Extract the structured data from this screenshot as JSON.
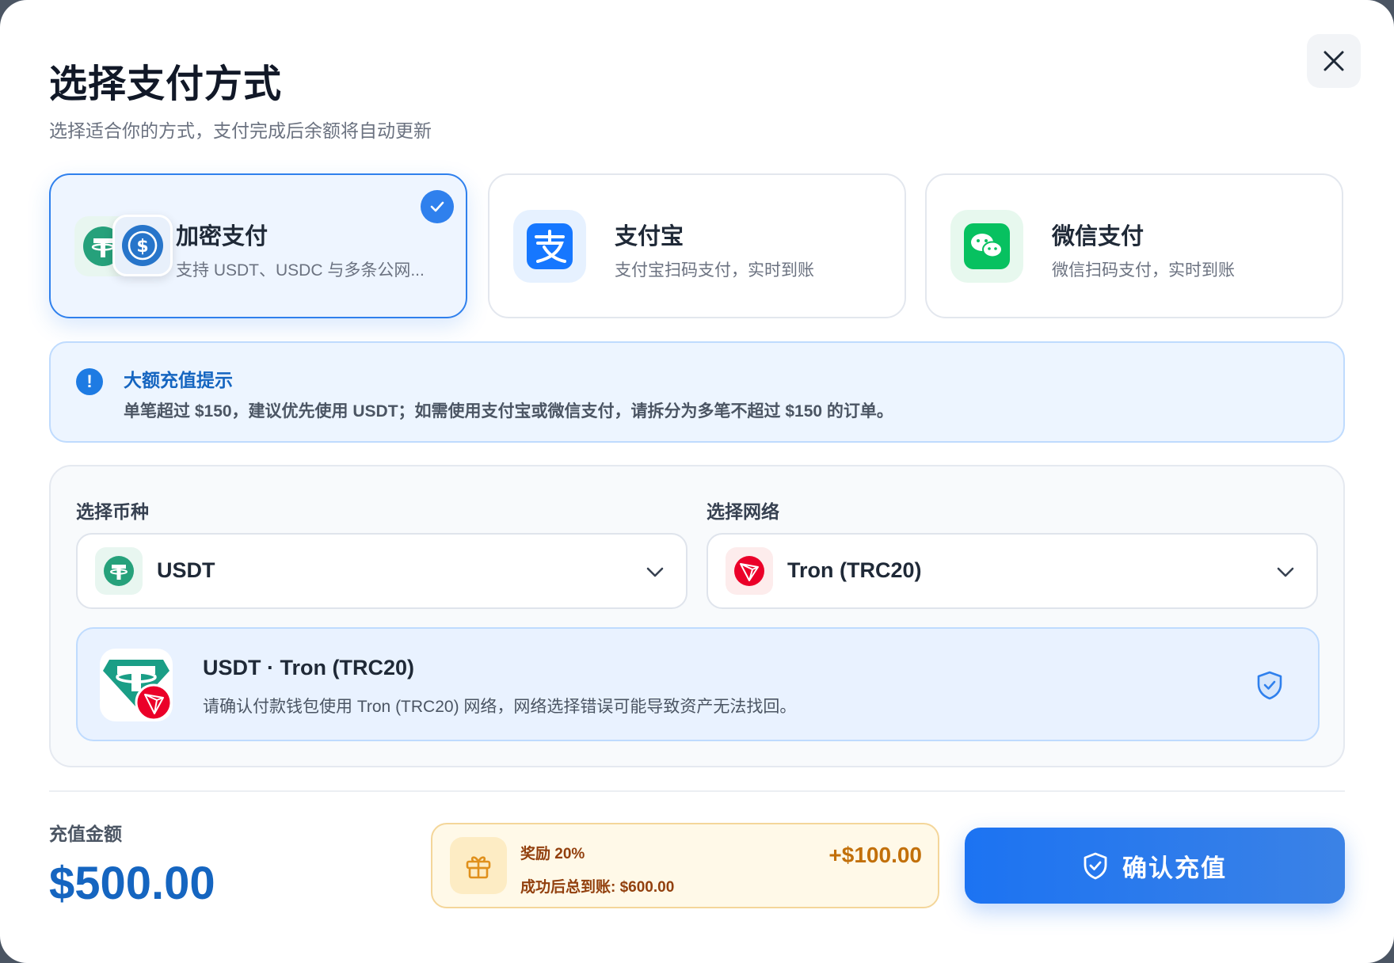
{
  "dialog": {
    "title": "选择支付方式",
    "subtitle": "选择适合你的方式，支付完成后余额将自动更新"
  },
  "methods": [
    {
      "name": "加密支付",
      "desc": "支持 USDT、USDC 与多条公网...",
      "selected": true,
      "icons": [
        "tether-icon",
        "usdc-icon"
      ]
    },
    {
      "name": "支付宝",
      "desc": "支付宝扫码支付，实时到账",
      "selected": false,
      "icons": [
        "alipay-icon"
      ]
    },
    {
      "name": "微信支付",
      "desc": "微信扫码支付，实时到账",
      "selected": false,
      "icons": [
        "wechat-icon"
      ]
    }
  ],
  "notice": {
    "title": "大额充值提示",
    "text": "单笔超过 $150，建议优先使用 USDT；如需使用支付宝或微信支付，请拆分为多笔不超过 $150 的订单。"
  },
  "crypto": {
    "currency_label": "选择币种",
    "currency_value": "USDT",
    "network_label": "选择网络",
    "network_value": "Tron (TRC20)",
    "info_title": "USDT · Tron (TRC20)",
    "info_text": "请确认付款钱包使用 Tron (TRC20) 网络，网络选择错误可能导致资产无法找回。"
  },
  "footer": {
    "amount_label": "充值金额",
    "amount_value": "$500.00",
    "bonus_rate": "奖励 20%",
    "bonus_total": "成功后总到账: $600.00",
    "bonus_amount": "+$100.00",
    "confirm_label": "确认充值"
  },
  "colors": {
    "primary": "#2f80ed",
    "tether": "#26a17b",
    "usdc": "#2775ca",
    "alipay": "#1677ff",
    "wechat": "#07c160",
    "tron": "#eb0029",
    "bonus": "#c2700a"
  }
}
